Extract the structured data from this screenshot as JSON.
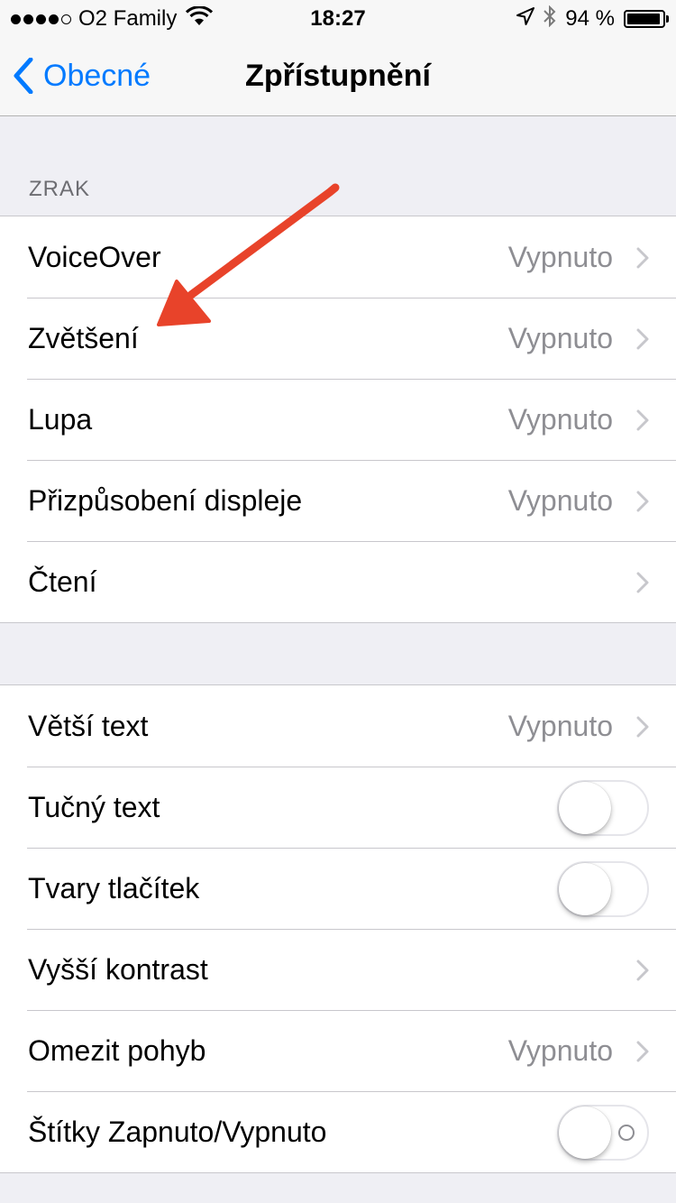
{
  "status_bar": {
    "carrier": "O2 Family",
    "time": "18:27",
    "battery": "94 %",
    "battery_level": 0.94,
    "icons": [
      "signal-dots-icon",
      "wifi-icon",
      "location-icon",
      "bluetooth-icon",
      "battery-icon"
    ]
  },
  "nav": {
    "back_label": "Obecné",
    "title": "Zpřístupnění"
  },
  "section_vision": {
    "header": "ZRAK",
    "rows": [
      {
        "label": "VoiceOver",
        "value": "Vypnuto"
      },
      {
        "label": "Zvětšení",
        "value": "Vypnuto"
      },
      {
        "label": "Lupa",
        "value": "Vypnuto"
      },
      {
        "label": "Přizpůsobení displeje",
        "value": "Vypnuto"
      },
      {
        "label": "Čtení",
        "value": ""
      }
    ]
  },
  "section_text": {
    "rows": [
      {
        "label": "Větší text",
        "value": "Vypnuto",
        "type": "disclosure"
      },
      {
        "label": "Tučný text",
        "type": "toggle",
        "on": false
      },
      {
        "label": "Tvary tlačítek",
        "type": "toggle",
        "on": false
      },
      {
        "label": "Vyšší kontrast",
        "value": "",
        "type": "disclosure"
      },
      {
        "label": "Omezit pohyb",
        "value": "Vypnuto",
        "type": "disclosure"
      },
      {
        "label": "Štítky Zapnuto/Vypnuto",
        "type": "toggle",
        "on": false
      }
    ]
  },
  "colors": {
    "accent": "#007aff",
    "annotation_arrow": "#e8432a",
    "secondary_text": "#8e8e93",
    "background": "#efeff4"
  }
}
